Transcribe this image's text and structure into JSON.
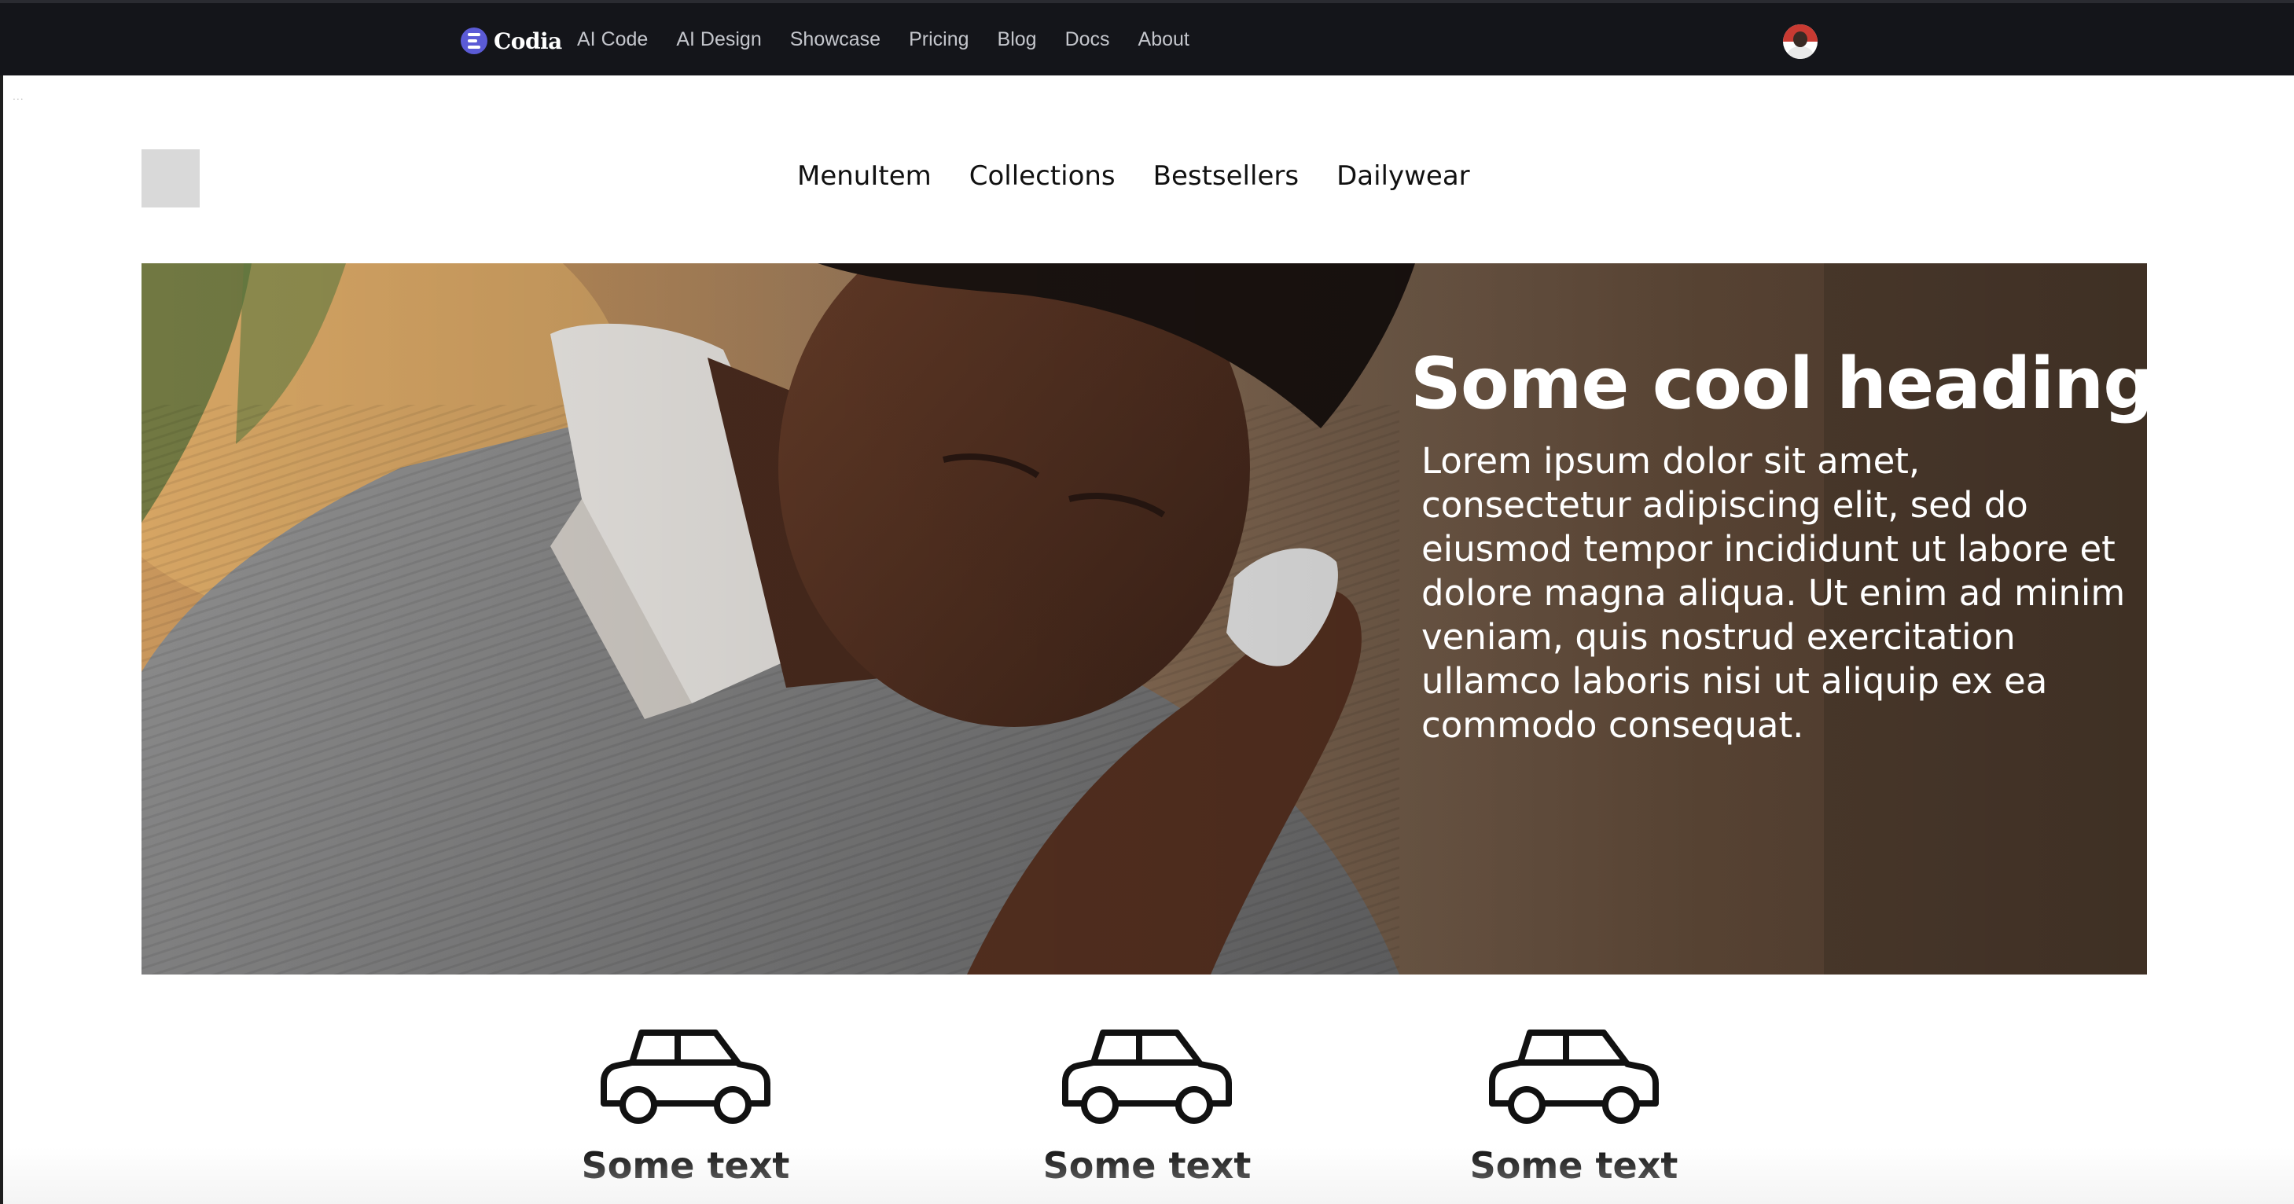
{
  "topbar": {
    "brand": "Codia",
    "links": [
      "AI Code",
      "AI Design",
      "Showcase",
      "Pricing",
      "Blog",
      "Docs",
      "About"
    ]
  },
  "page_dots": "...",
  "site": {
    "nav": [
      "MenuItem",
      "Collections",
      "Bestsellers",
      "Dailywear"
    ]
  },
  "hero": {
    "title": "Some cool heading",
    "body": "Lorem ipsum dolor sit amet, consectetur adipiscing elit, sed do eiusmod tempor incididunt ut labore et dolore magna aliqua. Ut enim ad minim veniam, quis nostrud exercitation ullamco laboris nisi ut aliquip ex ea commodo consequat."
  },
  "features": [
    {
      "icon": "car-icon",
      "label": "Some text"
    },
    {
      "icon": "car-icon",
      "label": "Some text"
    },
    {
      "icon": "car-icon",
      "label": "Some text"
    }
  ],
  "colors": {
    "topbar_bg": "#14151a",
    "brand_accent": "#5b5bd6",
    "topbar_link": "#c4c6cc",
    "placeholder_gray": "#d9d9d9",
    "text_dark": "#111111",
    "hero_text": "#ffffff"
  }
}
